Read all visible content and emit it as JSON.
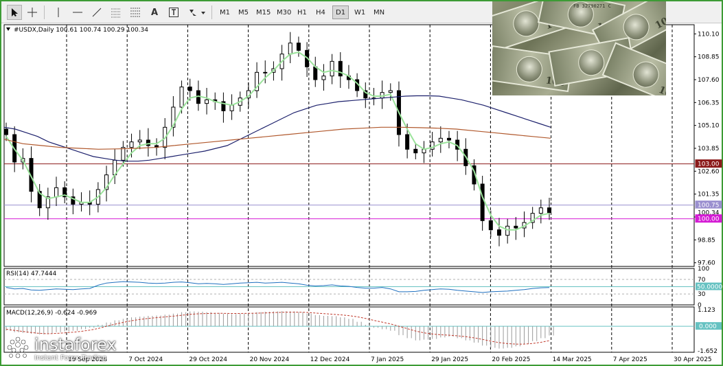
{
  "toolbar": {
    "tools": [
      "cursor",
      "crosshair",
      "vertical-line",
      "horizontal-line",
      "trendline",
      "fibonacci",
      "text",
      "text-label",
      "arrows"
    ],
    "text_tool_label": "A",
    "timeframes": [
      "M1",
      "M5",
      "M15",
      "M30",
      "H1",
      "H4",
      "D1",
      "W1",
      "MN"
    ],
    "active_timeframe": "D1"
  },
  "chart_data": [
    {
      "type": "candlestick",
      "title": "#USDX,Daily",
      "ohlc_header": "100.61 100.74 100.29 100.34",
      "x_labels": [
        "19 Sep 2024",
        "7 Oct 2024",
        "29 Oct 2024",
        "20 Nov 2024",
        "12 Dec 2024",
        "7 Jan 2025",
        "29 Jan 2025",
        "20 Feb 2025",
        "14 Mar 2025",
        "7 Apr 2025",
        "30 Apr 2025"
      ],
      "y_ticks": [
        "110.10",
        "108.85",
        "107.60",
        "106.35",
        "105.10",
        "103.85",
        "102.60",
        "101.35",
        "100.10",
        "98.85",
        "97.60"
      ],
      "ylim": [
        97.4,
        110.6
      ],
      "price_labels": [
        {
          "text": "103.00",
          "value": 103.0,
          "color": "#8b1a1a"
        },
        {
          "text": "100.75",
          "value": 100.75,
          "color": "#9a8fcf"
        },
        {
          "text": "100.34",
          "value": 100.34,
          "color": "#ffffff"
        },
        {
          "text": "100.00",
          "value": 100.0,
          "color": "#d41cd4"
        }
      ],
      "horizontal_levels": [
        {
          "value": 103.0,
          "color": "#8b1a1a"
        },
        {
          "value": 100.75,
          "color": "#9a8fcf"
        },
        {
          "value": 100.0,
          "color": "#d41cd4"
        }
      ],
      "close_series": [
        104.6,
        103.1,
        103.3,
        101.5,
        100.6,
        101.2,
        101.7,
        101.2,
        100.8,
        100.9,
        100.8,
        101.6,
        102.4,
        103.2,
        103.9,
        104.2,
        104.3,
        104.0,
        103.9,
        105.0,
        106.1,
        107.2,
        107.0,
        106.3,
        106.5,
        106.4,
        105.9,
        106.2,
        106.6,
        107.0,
        108.0,
        108.0,
        108.2,
        109.0,
        109.6,
        109.2,
        108.3,
        107.6,
        107.8,
        108.6,
        107.8,
        107.6,
        107.0,
        106.6,
        106.6,
        106.9,
        107.0,
        104.6,
        103.8,
        103.6,
        103.8,
        104.2,
        104.4,
        104.3,
        103.8,
        102.9,
        101.9,
        99.9,
        99.4,
        99.1,
        99.6,
        99.5,
        99.8,
        100.3,
        100.6,
        100.34
      ],
      "series": [
        {
          "name": "",
          "color": "#9be39b",
          "values": [
            104.5,
            103.8,
            103.2,
            102.3,
            101.4,
            101.1,
            101.2,
            101.3,
            101.1,
            100.9,
            100.9,
            101.2,
            101.7,
            102.4,
            103.0,
            103.6,
            104.0,
            104.1,
            104.1,
            104.4,
            105.1,
            106.0,
            106.6,
            106.7,
            106.6,
            106.4,
            106.3,
            106.2,
            106.4,
            106.7,
            107.2,
            107.7,
            108.1,
            108.6,
            109.0,
            109.1,
            108.8,
            108.3,
            108.0,
            108.1,
            108.0,
            107.8,
            107.4,
            106.9,
            106.7,
            106.7,
            106.8,
            105.8,
            104.9,
            104.1,
            103.8,
            103.9,
            104.1,
            104.2,
            104.0,
            103.4,
            102.6,
            101.2,
            100.2,
            99.6,
            99.4,
            99.4,
            99.6,
            99.9,
            100.2,
            100.3
          ]
        },
        {
          "name": "",
          "color": "#1b1f6b",
          "values": [
            105.0,
            104.9,
            104.7,
            104.5,
            104.2,
            104.0,
            103.8,
            103.6,
            103.4,
            103.3,
            103.2,
            103.15,
            103.15,
            103.2,
            103.3,
            103.4,
            103.5,
            103.6,
            103.7,
            103.85,
            104.0,
            104.3,
            104.6,
            104.9,
            105.2,
            105.5,
            105.8,
            106.0,
            106.2,
            106.3,
            106.4,
            106.45,
            106.5,
            106.55,
            106.6,
            106.65,
            106.7,
            106.72,
            106.72,
            106.7,
            106.6,
            106.5,
            106.35,
            106.2,
            106.0,
            105.8,
            105.6,
            105.4,
            105.2,
            105.0
          ]
        },
        {
          "name": "",
          "color": "#b0572b",
          "values": [
            104.35,
            104.1,
            104.0,
            103.9,
            103.85,
            103.8,
            103.82,
            103.85,
            103.9,
            104.0,
            104.1,
            104.2,
            104.3,
            104.4,
            104.5,
            104.6,
            104.7,
            104.8,
            104.9,
            104.95,
            105.0,
            105.0,
            104.98,
            104.95,
            104.9,
            104.8,
            104.7,
            104.6,
            104.5,
            104.4
          ]
        }
      ]
    },
    {
      "type": "line",
      "title": "RSI(14) 47.7444",
      "y_ticks": [
        "100",
        "70",
        "30",
        "0"
      ],
      "ylim": [
        0,
        100
      ],
      "level_label": "50.0000",
      "levels": [
        70,
        50,
        30
      ],
      "values": [
        48,
        44,
        45,
        41,
        40,
        42,
        44,
        43,
        42,
        44,
        45,
        54,
        60,
        62,
        64,
        63,
        62,
        60,
        59,
        60,
        62,
        63,
        61,
        58,
        59,
        58,
        56,
        58,
        60,
        61,
        62,
        60,
        61,
        62,
        60,
        58,
        54,
        52,
        53,
        55,
        52,
        51,
        48,
        46,
        46,
        48,
        44,
        36,
        36,
        37,
        40,
        42,
        44,
        43,
        40,
        38,
        36,
        34,
        36,
        37,
        38,
        40,
        42,
        45,
        47,
        47.74
      ]
    },
    {
      "type": "bar",
      "title": "MACD(12,26,9) -0.624 -0.969",
      "y_ticks": [
        "1.123",
        "0.000",
        "-1.652"
      ],
      "ylim": [
        -1.75,
        1.3
      ],
      "zero_label": "0.000",
      "histogram": [
        -0.3,
        -0.4,
        -0.45,
        -0.5,
        -0.55,
        -0.5,
        -0.4,
        -0.35,
        -0.3,
        -0.2,
        -0.1,
        0.1,
        0.25,
        0.4,
        0.5,
        0.6,
        0.65,
        0.7,
        0.72,
        0.78,
        0.85,
        0.95,
        1.0,
        0.98,
        0.95,
        0.9,
        0.85,
        0.82,
        0.85,
        0.9,
        0.95,
        0.98,
        1.0,
        1.02,
        1.0,
        0.95,
        0.85,
        0.75,
        0.7,
        0.68,
        0.6,
        0.5,
        0.3,
        0.1,
        -0.1,
        -0.2,
        -0.3,
        -0.6,
        -0.8,
        -0.95,
        -0.9,
        -0.85,
        -0.75,
        -0.7,
        -0.8,
        -0.95,
        -1.1,
        -1.3,
        -1.45,
        -1.5,
        -1.45,
        -1.35,
        -1.2,
        -1.0,
        -0.8,
        -0.62
      ],
      "signal": [
        -0.2,
        -0.28,
        -0.35,
        -0.42,
        -0.48,
        -0.5,
        -0.48,
        -0.44,
        -0.4,
        -0.34,
        -0.26,
        -0.15,
        0.0,
        0.14,
        0.26,
        0.37,
        0.46,
        0.53,
        0.58,
        0.63,
        0.68,
        0.74,
        0.8,
        0.84,
        0.86,
        0.87,
        0.87,
        0.86,
        0.86,
        0.87,
        0.88,
        0.9,
        0.92,
        0.94,
        0.95,
        0.95,
        0.93,
        0.89,
        0.85,
        0.81,
        0.77,
        0.72,
        0.64,
        0.53,
        0.4,
        0.28,
        0.16,
        0.0,
        -0.16,
        -0.32,
        -0.44,
        -0.52,
        -0.57,
        -0.6,
        -0.64,
        -0.7,
        -0.78,
        -0.88,
        -1.0,
        -1.1,
        -1.17,
        -1.2,
        -1.2,
        -1.16,
        -1.08,
        -0.97
      ]
    }
  ],
  "brand": {
    "name": "instaforex",
    "tagline": "Instant Forex Trading"
  },
  "photo": {
    "denomination": "100",
    "serial": "FB 32790271 C"
  }
}
